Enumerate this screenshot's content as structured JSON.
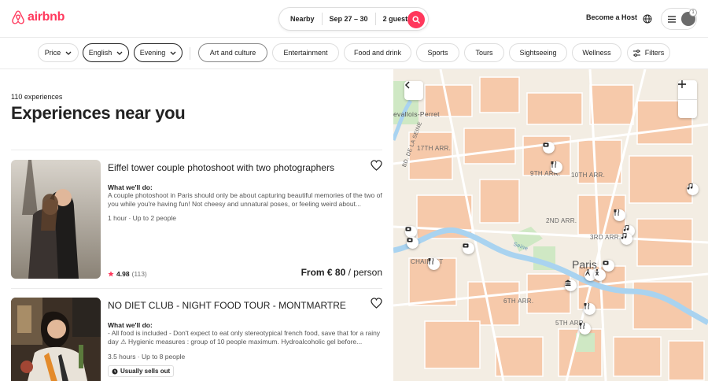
{
  "header": {
    "logo_text": "airbnb",
    "search": {
      "location": "Nearby",
      "dates": "Sep 27 – 30",
      "guests": "2 guests"
    },
    "become_host": "Become a Host",
    "notifications": "1"
  },
  "filters": {
    "dropdowns": [
      "Price",
      "English",
      "Evening"
    ],
    "categories": [
      "Art and culture",
      "Entertainment",
      "Food and drink",
      "Sports",
      "Tours",
      "Sightseeing",
      "Wellness"
    ],
    "filters_label": "Filters"
  },
  "results": {
    "count": "110 experiences",
    "heading": "Experiences near you"
  },
  "listings": [
    {
      "title": "Eiffel tower couple photoshoot with two photographers",
      "what_label": "What we'll do:",
      "description": "A couple photoshoot in Paris should only be about capturing beautiful memories of the two of you while you're having fun! Not cheesy and unnatural poses, or feeling weird about...",
      "meta": "1 hour · Up to 2 people",
      "rating": "4.98",
      "reviews": "(113)",
      "price": "From € 80",
      "price_unit": " / person"
    },
    {
      "title": "NO DIET CLUB - NIGHT FOOD TOUR - MONTMARTRE",
      "what_label": "What we'll do:",
      "description": "- All food is included - Don't expect to eat only stereotypical french food, save that for a rainy day ⚠ Hygienic measures : group of 10 people maximum. Hydroalcoholic gel before...",
      "meta": "3.5 hours · Up to 8 people",
      "badge": "Usually sells out"
    }
  ],
  "map": {
    "labels": {
      "levallois": "evallois-Perret",
      "arr17": "17TH ARR.",
      "arr9": "9TH ARR.",
      "arr10": "10TH ARR.",
      "chaillot": "CHAILLOT",
      "arr2": "2ND ARR.",
      "arr3": "3RD ARR.",
      "arr6": "6TH ARR.",
      "arr5": "5TH ARR.",
      "paris": "Paris",
      "seine": "Seine",
      "bd_seine": "BD. DE LA SEINE"
    }
  },
  "colors": {
    "brand": "#ff385c",
    "map_water": "#a9d3f0",
    "map_block": "#f6c7a6",
    "map_park": "#cfe8c4"
  }
}
